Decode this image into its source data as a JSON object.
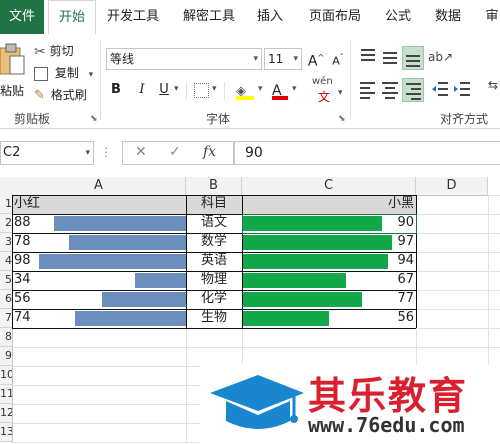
{
  "tabs": [
    "文件",
    "开始",
    "开发工具",
    "解密工具",
    "插入",
    "页面布局",
    "公式",
    "数据",
    "审"
  ],
  "clipboard": {
    "paste_label": "粘贴",
    "cut_label": "剪切",
    "copy_label": "复制",
    "format_painter_label": "格式刷",
    "group_label": "剪贴板"
  },
  "font": {
    "name": "等线",
    "size": "11",
    "bold": "B",
    "italic": "I",
    "underline": "U",
    "grow": "A",
    "shrink": "A",
    "wen": "wén",
    "font_color_glyph": "A",
    "group_label": "字体"
  },
  "alignment": {
    "group_label": "对齐方式"
  },
  "formula_bar": {
    "name_box": "C2",
    "cancel": "✕",
    "enter": "✓",
    "fx": "fx",
    "value": "90"
  },
  "columns": [
    "A",
    "B",
    "C",
    "D"
  ],
  "rows": [
    "1",
    "2",
    "3",
    "4",
    "5",
    "6",
    "7",
    "8",
    "9",
    "10",
    "11",
    "12",
    "13"
  ],
  "table": {
    "header": {
      "a": "小红",
      "b": "科目",
      "c": "小黑"
    },
    "rows": [
      {
        "a": "88",
        "b": "语文",
        "c": "90"
      },
      {
        "a": "78",
        "b": "数学",
        "c": "97"
      },
      {
        "a": "98",
        "b": "英语",
        "c": "94"
      },
      {
        "a": "34",
        "b": "物理",
        "c": "67"
      },
      {
        "a": "56",
        "b": "化学",
        "c": "77"
      },
      {
        "a": "74",
        "b": "生物",
        "c": "56"
      }
    ],
    "bar_max": 100,
    "left_bar_color": "#6c8ebf",
    "right_bar_color": "#12a84a"
  },
  "watermark": {
    "brand": "其乐教育",
    "url": "www.76edu.com",
    "brand_color": "#d8202f",
    "cap_color": "#1a86d0"
  }
}
